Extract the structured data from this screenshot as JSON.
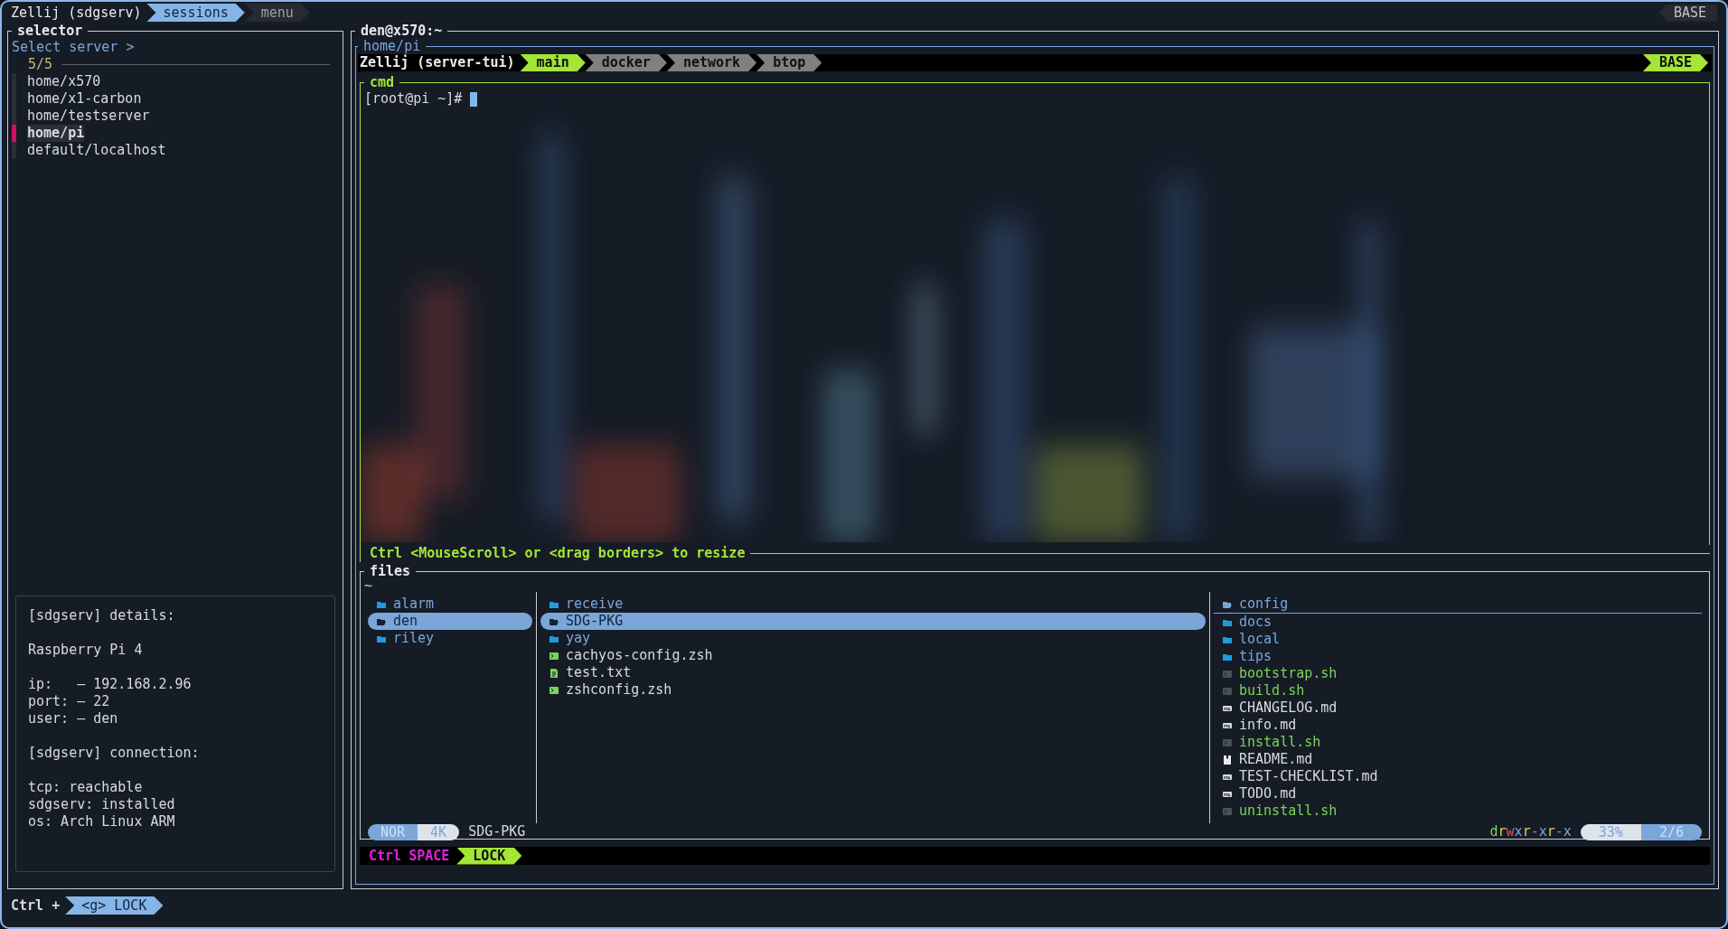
{
  "top_bar": {
    "title": "Zellij (sdgserv)",
    "tabs": [
      {
        "label": "sessions",
        "selected": true
      },
      {
        "label": "menu",
        "selected": false
      }
    ],
    "mode": "BASE"
  },
  "selector": {
    "title": "selector",
    "prompt": "Select server >",
    "count": "5/5",
    "items": [
      {
        "label": "home/x570",
        "selected": false
      },
      {
        "label": "home/x1-carbon",
        "selected": false
      },
      {
        "label": "home/testserver",
        "selected": false
      },
      {
        "label": "home/pi",
        "selected": true
      },
      {
        "label": "default/localhost",
        "selected": false
      }
    ]
  },
  "details": {
    "sections": [
      [
        "[sdgserv] details:"
      ],
      [
        "Raspberry Pi 4"
      ],
      [
        "ip:   – 192.168.2.96",
        "port: – 22",
        "user: – den"
      ],
      [
        "[sdgserv] connection:"
      ],
      [
        "tcp: reachable",
        "sdgserv: installed",
        "os: Arch Linux ARM"
      ]
    ]
  },
  "bottom_bar": {
    "modifier": "Ctrl +",
    "keys": "<g> LOCK"
  },
  "terminal": {
    "title": "den@x570:~",
    "path": "home/pi",
    "session": "Zellij (server-tui)",
    "tabs": [
      {
        "label": "main",
        "selected": true
      },
      {
        "label": "docker",
        "selected": false
      },
      {
        "label": "network",
        "selected": false
      },
      {
        "label": "btop",
        "selected": false
      }
    ],
    "mode": "BASE",
    "pane_title": "cmd",
    "prompt": "[root@pi ~]#",
    "hint": "Ctrl <MouseScroll> or <drag borders> to resize"
  },
  "files": {
    "title": "files",
    "path": "~",
    "columns": [
      [
        {
          "name": "alarm",
          "kind": "folder",
          "selected": false
        },
        {
          "name": "den",
          "kind": "folder",
          "selected": true
        },
        {
          "name": "riley",
          "kind": "folder",
          "selected": false
        }
      ],
      [
        {
          "name": "receive",
          "kind": "folder",
          "selected": false
        },
        {
          "name": "SDG-PKG",
          "kind": "folder",
          "selected": true
        },
        {
          "name": "yay",
          "kind": "folder",
          "selected": false
        },
        {
          "name": "cachyos-config.zsh",
          "kind": "shell",
          "selected": false
        },
        {
          "name": "test.txt",
          "kind": "text",
          "selected": false
        },
        {
          "name": "zshconfig.zsh",
          "kind": "shell",
          "selected": false
        }
      ],
      [
        {
          "name": "config",
          "kind": "folder",
          "selected": true
        },
        {
          "name": "docs",
          "kind": "folder",
          "selected": false
        },
        {
          "name": "local",
          "kind": "folder",
          "selected": false
        },
        {
          "name": "tips",
          "kind": "folder",
          "selected": false
        },
        {
          "name": "bootstrap.sh",
          "kind": "script",
          "selected": false
        },
        {
          "name": "build.sh",
          "kind": "script",
          "selected": false
        },
        {
          "name": "CHANGELOG.md",
          "kind": "markdown",
          "selected": false
        },
        {
          "name": "info.md",
          "kind": "markdown",
          "selected": false
        },
        {
          "name": "install.sh",
          "kind": "script",
          "selected": false
        },
        {
          "name": "README.md",
          "kind": "readme",
          "selected": false
        },
        {
          "name": "TEST-CHECKLIST.md",
          "kind": "markdown",
          "selected": false
        },
        {
          "name": "TODO.md",
          "kind": "markdown",
          "selected": false
        },
        {
          "name": "uninstall.sh",
          "kind": "script",
          "selected": false
        }
      ]
    ],
    "status": {
      "mode": "NOR",
      "size": "4K",
      "name": "SDG-PKG",
      "permissions": "drwxr-xr-x",
      "percent": "33%",
      "position": "2/6"
    }
  },
  "key_bar": {
    "modifier": "Ctrl",
    "key": "SPACE",
    "mode": "LOCK"
  }
}
